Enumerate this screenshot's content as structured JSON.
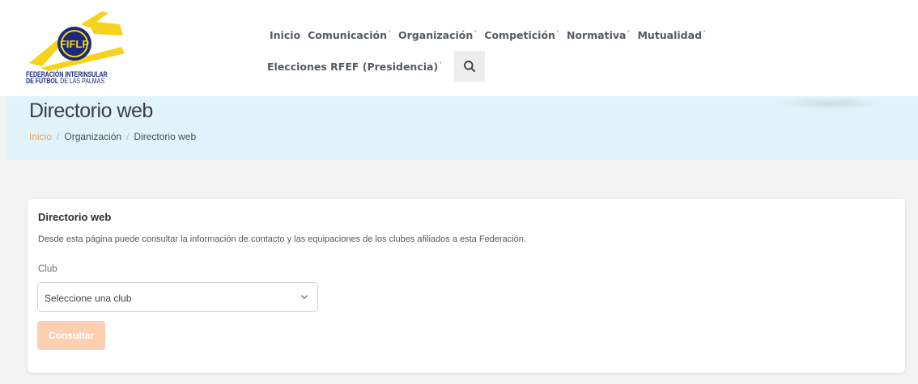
{
  "logo": {
    "emblem_text": "FIFLP",
    "line1_bold": "FEDERACIÓN INTERINSULAR",
    "line2_bold": "DE FÚTBOL",
    "line2_rest": " DE LAS PALMAS",
    "colors": {
      "yellow": "#f6d21c",
      "navy": "#1a2a7a"
    }
  },
  "nav": {
    "row1": [
      {
        "label": "Inicio",
        "has_dropdown": false
      },
      {
        "label": "Comunicación",
        "has_dropdown": true
      },
      {
        "label": "Organización",
        "has_dropdown": true
      },
      {
        "label": "Competición",
        "has_dropdown": true
      },
      {
        "label": "Normativa",
        "has_dropdown": true
      },
      {
        "label": "Mutualidad",
        "has_dropdown": true
      }
    ],
    "row2": [
      {
        "label": "Elecciones RFEF (Presidencia)",
        "has_dropdown": true
      }
    ],
    "chevron": "˅",
    "search_icon": "search-icon"
  },
  "hero": {
    "title": "Directorio web",
    "breadcrumb": [
      "Inicio",
      "Organización",
      "Directorio web"
    ],
    "separator": "/",
    "background": "#e1f3fa",
    "link_color": "#f0a35c"
  },
  "card": {
    "title": "Directorio web",
    "description": "Desde esta página puede consultar la información de contacto y las equipaciones de los clubes afiliados a esta Federación.",
    "field_label": "Club",
    "select_value": "Seleccione una club",
    "button_label": "Consultar",
    "button_color": "#fccfb0"
  }
}
